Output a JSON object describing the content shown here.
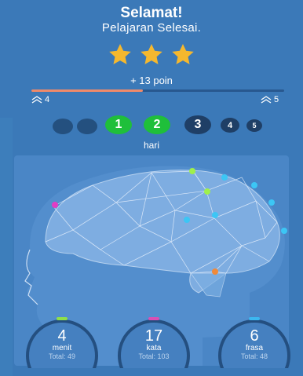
{
  "header": {
    "title": "Selamat!",
    "subtitle": "Pelajaran Selesai."
  },
  "rating": {
    "stars": 3
  },
  "points": {
    "label": "+ 13 poin",
    "progress": 0.44,
    "level_from": "4",
    "level_to": "5"
  },
  "streak": {
    "days": [
      "",
      "",
      "1",
      "2",
      "3",
      "4",
      "5"
    ],
    "label": "hari"
  },
  "stats": [
    {
      "value": "4",
      "unit": "menit",
      "total": "Total: 49",
      "color": "#8ee04a"
    },
    {
      "value": "17",
      "unit": "kata",
      "total": "Total: 103",
      "color": "#d94fb4"
    },
    {
      "value": "6",
      "unit": "frasa",
      "total": "Total: 48",
      "color": "#3cb7f0"
    }
  ],
  "colors": {
    "background": "#3b79b8",
    "panel": "#4a86c6",
    "green": "#1fbf3a",
    "dark_circle": "#1f3f66",
    "star": "#f5b82e",
    "progress": "#f08a6a"
  }
}
